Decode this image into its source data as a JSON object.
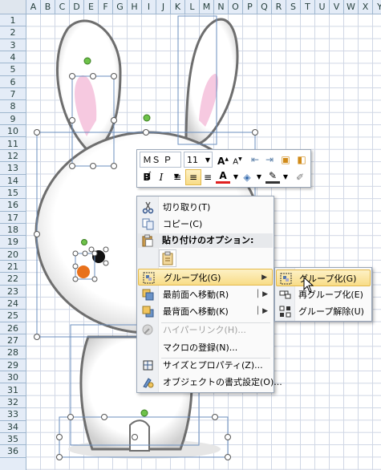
{
  "columns": [
    "A",
    "B",
    "C",
    "D",
    "E",
    "F",
    "G",
    "H",
    "I",
    "J",
    "K",
    "L",
    "M",
    "N",
    "O",
    "P",
    "Q",
    "R",
    "S",
    "T",
    "U",
    "V",
    "W",
    "X",
    "Y"
  ],
  "rows": [
    "1",
    "2",
    "3",
    "4",
    "5",
    "6",
    "7",
    "8",
    "9",
    "10",
    "11",
    "12",
    "13",
    "14",
    "15",
    "16",
    "17",
    "18",
    "19",
    "20",
    "21",
    "22",
    "23",
    "24",
    "25",
    "26",
    "27",
    "28",
    "29",
    "30",
    "31",
    "32",
    "33",
    "34",
    "35",
    "36"
  ],
  "minibar": {
    "font_name": "ＭＳ Ｐゴ",
    "font_size": "11",
    "grow_font": "A",
    "shrink_font": "A",
    "bold": "B",
    "italic": "I",
    "font_color_letter": "A"
  },
  "context_menu": {
    "cut": "切り取り(T)",
    "copy": "コピー(C)",
    "paste_options": "貼り付けのオプション:",
    "group": "グループ化(G)",
    "bring_front": "最前面へ移動(R)",
    "send_back": "最背面へ移動(K)",
    "hyperlink": "ハイパーリンク(H)...",
    "assign_macro": "マクロの登録(N)...",
    "size_props": "サイズとプロパティ(Z)...",
    "format_object": "オブジェクトの書式設定(O)..."
  },
  "submenu": {
    "group": "グループ化(G)",
    "regroup": "再グループ化(E)",
    "ungroup": "グループ解除(U)"
  },
  "colors": {
    "highlight_top": "#fdf1c5",
    "highlight_bottom": "#f8dc87",
    "handle_green": "#6ec24a",
    "eye_orange": "#e8711c",
    "ear_pink": "#f6c9e0"
  }
}
